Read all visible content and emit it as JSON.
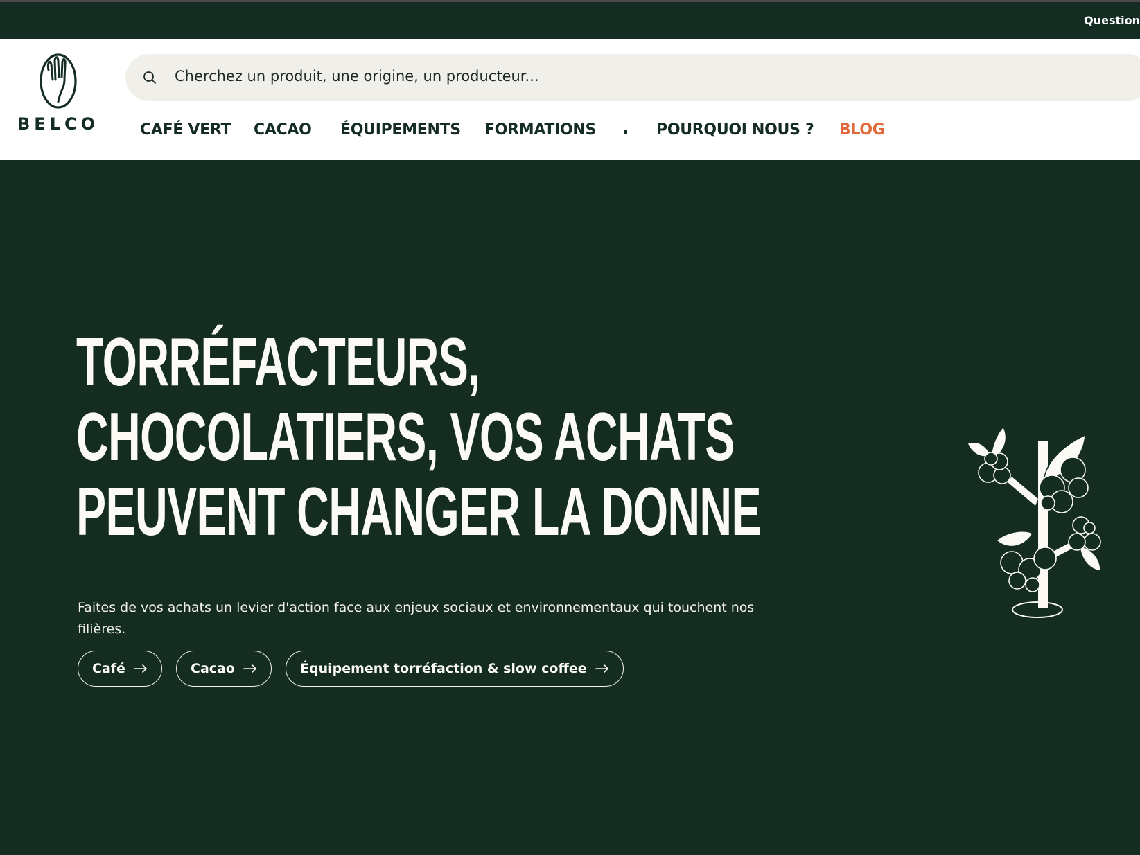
{
  "topbar": {
    "link_label": "Question"
  },
  "logo": {
    "text": "BELCO"
  },
  "search": {
    "placeholder": "Cherchez un produit, une origine, un producteur..."
  },
  "nav": {
    "items": [
      "CAFÉ VERT",
      "CACAO",
      "ÉQUIPEMENTS",
      "FORMATIONS"
    ],
    "secondary": [
      "POURQUOI NOUS ?"
    ],
    "blog": "BLOG"
  },
  "hero": {
    "title_lines": [
      "TORRÉFACTEURS,",
      "CHOCOLATIERS, VOS ACHATS",
      "PEUVENT CHANGER LA DONNE"
    ],
    "subtitle": "Faites de vos achats un levier d'action face aux enjeux sociaux et environnementaux qui touchent nos filières.",
    "buttons": [
      "Café",
      "Cacao",
      "Équipement torréfaction & slow coffee"
    ]
  },
  "colors": {
    "dark_green": "#142c22",
    "cream": "#fbfaf5",
    "accent": "#e06a3b",
    "search_bg": "#f0efea"
  },
  "icons": {
    "search": "search-icon",
    "arrow": "arrow-right-icon",
    "plant": "coffee-plant-illustration"
  }
}
